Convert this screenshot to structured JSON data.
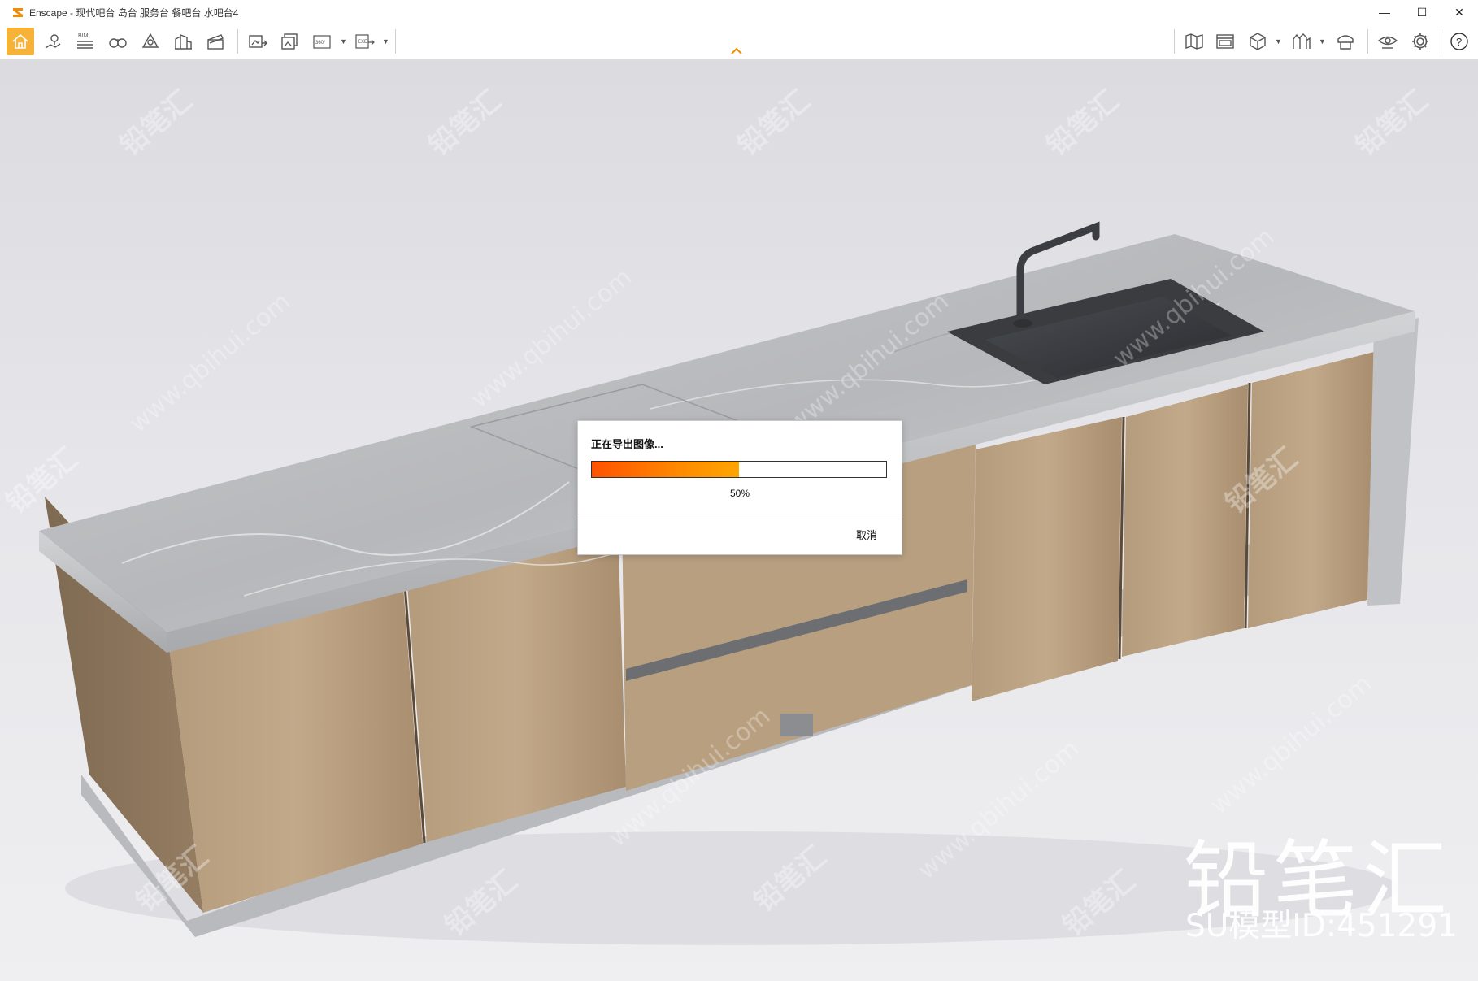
{
  "window": {
    "title": "Enscape - 现代吧台 岛台 服务台 餐吧台 水吧台4",
    "minimize_icon": "minimize-icon",
    "maximize_icon": "maximize-icon",
    "close_icon": "close-icon"
  },
  "toolbar": {
    "left_items": [
      {
        "name": "home-icon",
        "active": true
      },
      {
        "name": "location-pin-icon"
      },
      {
        "name": "bim-icon",
        "label": "BIM"
      },
      {
        "name": "binoculars-icon"
      },
      {
        "name": "light-view-icon"
      },
      {
        "name": "buildings-icon"
      },
      {
        "name": "video-editor-icon"
      },
      {
        "name": "export-image-icon"
      },
      {
        "name": "batch-render-icon"
      },
      {
        "name": "panorama-360-icon",
        "label": "360°"
      },
      {
        "name": "export-exe-icon",
        "label": "EXE"
      }
    ],
    "right_items": [
      {
        "name": "map-icon"
      },
      {
        "name": "material-editor-icon"
      },
      {
        "name": "cube-view-icon"
      },
      {
        "name": "skyline-icon"
      },
      {
        "name": "asset-library-icon"
      },
      {
        "name": "eye-visual-settings-icon"
      },
      {
        "name": "gear-icon"
      },
      {
        "name": "help-icon",
        "label": "?"
      }
    ],
    "collapse_icon": "chevron-up-icon"
  },
  "dialog": {
    "title": "正在导出图像...",
    "progress_percent": 50,
    "progress_label": "50%",
    "cancel_label": "取消"
  },
  "watermark": {
    "brand": "铅笔汇",
    "url": "www.qbihui.com",
    "model_id_text": "SU模型ID:451291"
  },
  "colors": {
    "accent": "#f6b338",
    "progress_start": "#ff5200",
    "progress_end": "#ffa600"
  }
}
